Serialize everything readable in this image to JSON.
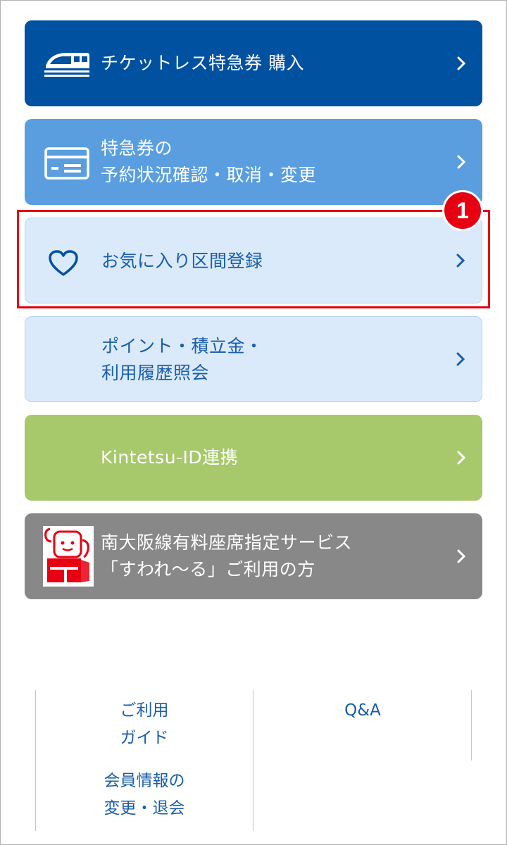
{
  "menu": {
    "ticketless": {
      "label": "チケットレス特急券 購入",
      "icon": "train-icon"
    },
    "reservation": {
      "label": "特急券の\n予約状況確認・取消・変更",
      "icon": "ticket-card-icon"
    },
    "favorite": {
      "label": "お気に入り区間登録",
      "icon": "heart-icon"
    },
    "points": {
      "label": "ポイント・積立金・\n利用履歴照会"
    },
    "kintetsu": {
      "label": "Kintetsu-ID連携"
    },
    "suwareru": {
      "label": "南大阪線有料座席指定サービス\n「すわれ〜る」ご利用の方",
      "icon": "suwareru-mascot"
    }
  },
  "annotation": {
    "badge_number": "1",
    "highlight_color": "#e60012"
  },
  "footer": {
    "guide": "ご利用\nガイド",
    "qa": "Q&A",
    "member": "会員情報の\n変更・退会"
  },
  "colors": {
    "ticketless_bg": "#0051a0",
    "reservation_bg": "#5a9edf",
    "light_bg": "#dbeafb",
    "kintetsu_bg": "#a8c86c",
    "suwareru_bg": "#888888",
    "link_text": "#1a5ea8"
  }
}
